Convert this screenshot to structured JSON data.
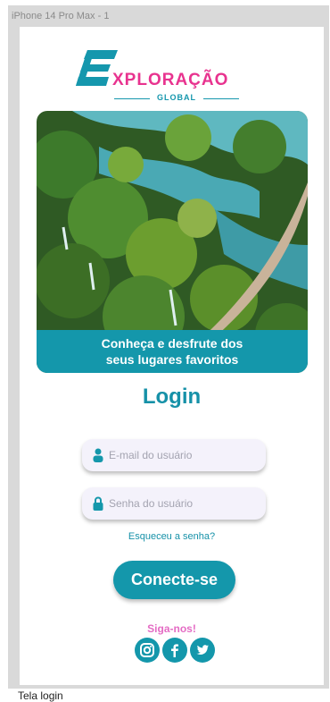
{
  "frame": {
    "label": "iPhone 14 Pro Max - 1",
    "caption": "Tela login"
  },
  "logo": {
    "word": "XPLORAÇÃO",
    "sub": "GLOBAL"
  },
  "hero": {
    "line1": "Conheça e desfrute dos",
    "line2": "seus lugares favoritos"
  },
  "login": {
    "title": "Login",
    "email_placeholder": "E-mail do usuário",
    "password_placeholder": "Senha do usuário",
    "forgot": "Esqueceu a senha?",
    "submit": "Conecte-se"
  },
  "social": {
    "title": "Siga-nos!",
    "icons": [
      "instagram-icon",
      "facebook-icon",
      "twitter-icon"
    ]
  },
  "colors": {
    "teal": "#1497ab",
    "pink": "#e8338f",
    "follow_pink": "#e46cc4"
  }
}
